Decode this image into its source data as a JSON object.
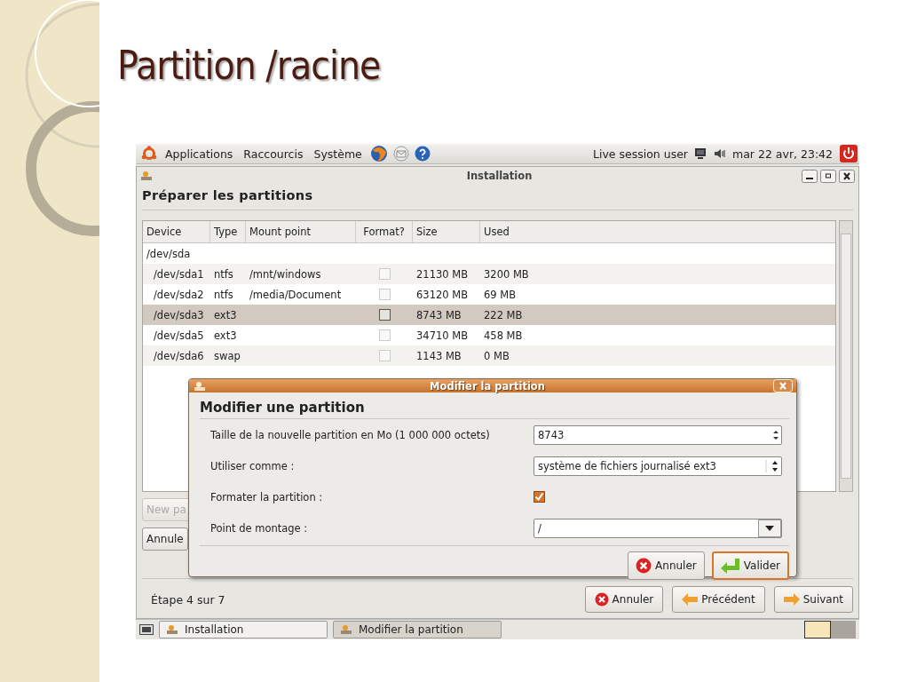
{
  "slide": {
    "title": "Partition /racine"
  },
  "top_panel": {
    "menus": [
      {
        "label": "Applications"
      },
      {
        "label": "Raccourcis"
      },
      {
        "label": "Système"
      }
    ],
    "user": "Live session user",
    "clock": "mar 22 avr, 23:42"
  },
  "window": {
    "title": "Installation",
    "heading": "Préparer les partitions",
    "table": {
      "columns": [
        "Device",
        "Type",
        "Mount point",
        "Format?",
        "Size",
        "Used"
      ],
      "rows": [
        {
          "device": "/dev/sda",
          "selected": false,
          "children": [
            {
              "device": "/dev/sda1",
              "type": "ntfs",
              "mount": "/mnt/windows",
              "format": false,
              "size": "21130 MB",
              "used": "3200 MB",
              "selected": false
            },
            {
              "device": "/dev/sda2",
              "type": "ntfs",
              "mount": "/media/Document",
              "format": false,
              "size": "63120 MB",
              "used": "69 MB",
              "selected": false
            },
            {
              "device": "/dev/sda3",
              "type": "ext3",
              "format": false,
              "size": "8743 MB",
              "used": "222 MB",
              "selected": true
            },
            {
              "device": "/dev/sda5",
              "type": "ext3",
              "format": false,
              "size": "34710 MB",
              "used": "458 MB",
              "selected": false
            },
            {
              "device": "/dev/sda6",
              "type": "swap",
              "format": false,
              "size": "1143 MB",
              "used": "0 MB",
              "selected": false
            }
          ]
        }
      ]
    },
    "buttons": [
      {
        "label": "New pa",
        "disabled": true
      },
      {
        "label": "Annule",
        "disabled": false
      }
    ],
    "step": "Étape 4 sur 7",
    "nav_buttons": [
      {
        "label": "Annuler",
        "kind": "cancel"
      },
      {
        "label": "Précédent",
        "kind": "back"
      },
      {
        "label": "Suivant",
        "kind": "forward"
      }
    ]
  },
  "dialog": {
    "title": "Modifier la partition",
    "heading": "Modifier une partition",
    "fields": [
      {
        "kind": "spin",
        "label": "Taille de la nouvelle partition en Mo (1 000 000 octets)",
        "value": "8743"
      },
      {
        "kind": "select",
        "label": "Utiliser comme :",
        "value": "système de fichiers journalisé ext3"
      },
      {
        "kind": "checkbox",
        "label": "Formater la partition :",
        "checked": true
      },
      {
        "kind": "combo",
        "label": "Point de montage :",
        "value": "/"
      }
    ],
    "buttons": [
      {
        "label": "Annuler",
        "kind": "cancel",
        "selected": false
      },
      {
        "label": "Valider",
        "kind": "ok",
        "selected": true
      }
    ]
  },
  "taskbar": {
    "items": [
      {
        "label": "Installation",
        "selected": false
      },
      {
        "label": "Modifier la partition",
        "selected": true
      }
    ]
  }
}
